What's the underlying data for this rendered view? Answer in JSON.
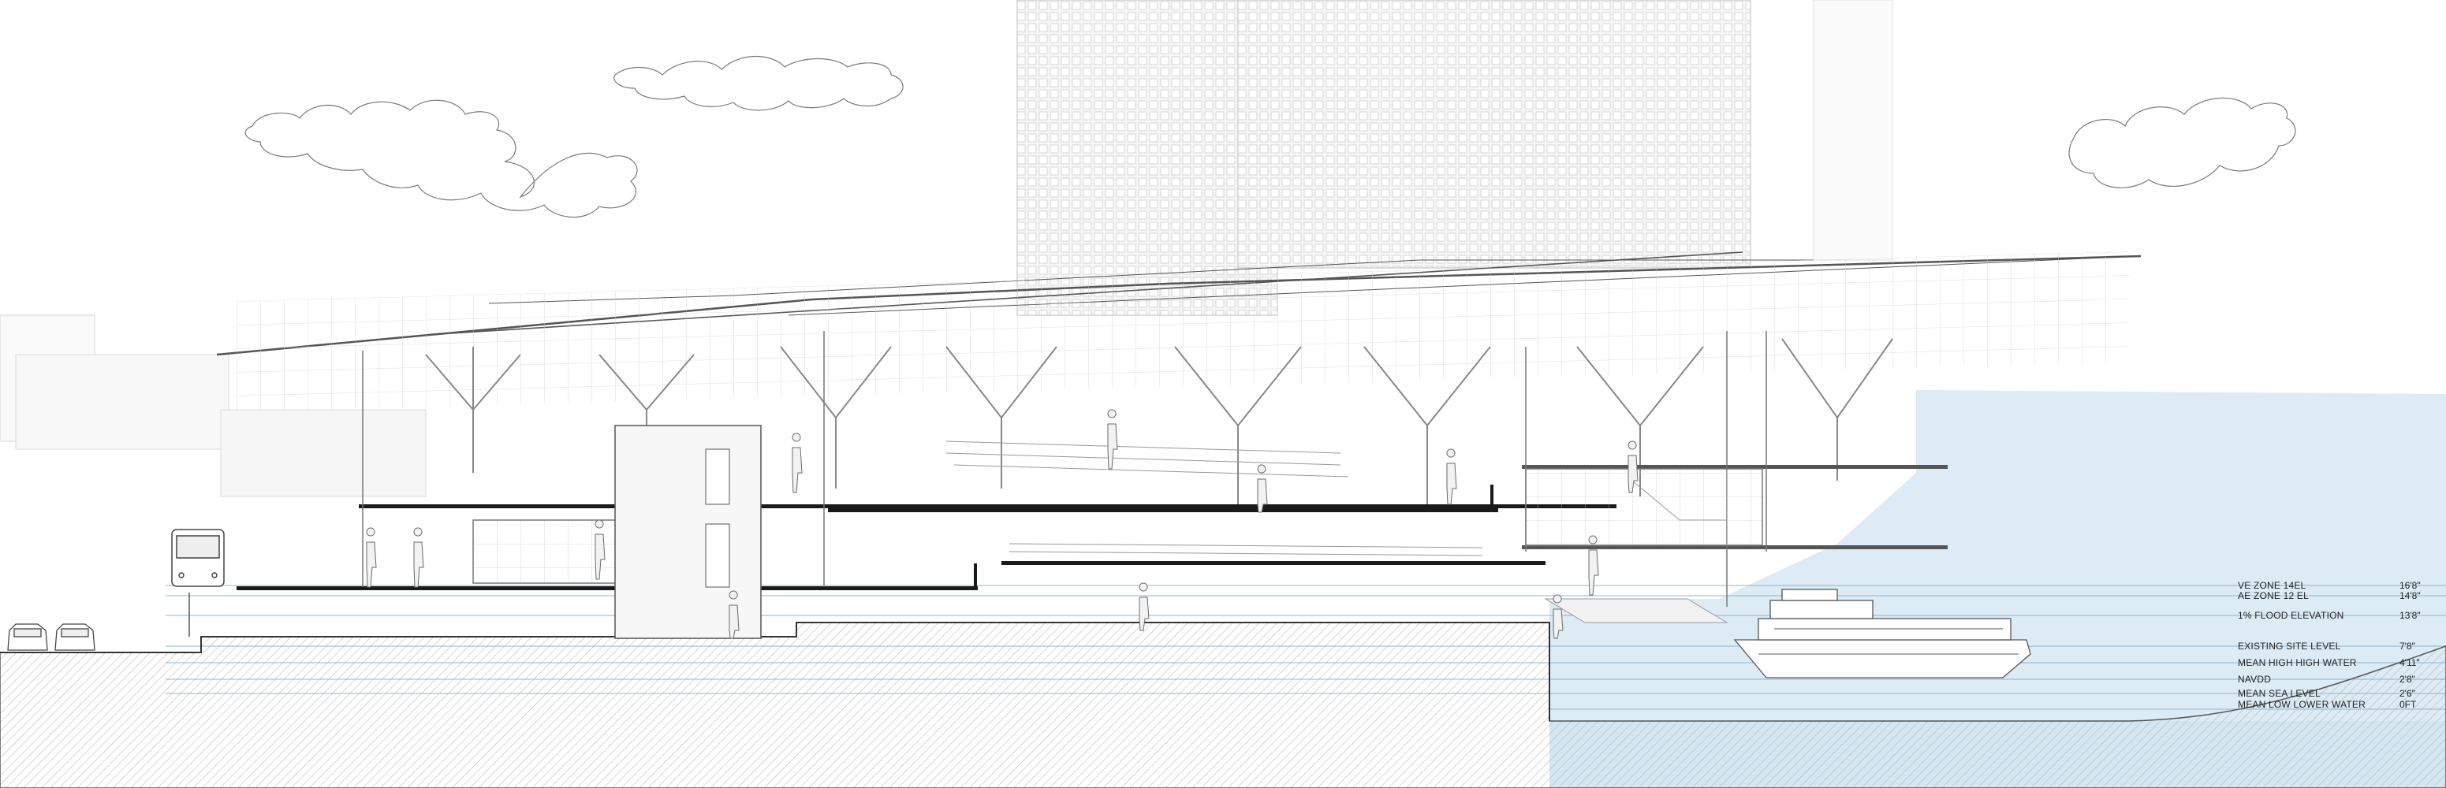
{
  "colors": {
    "water": "#dcebf4",
    "water_line": "#8fb6cf",
    "ground_hatch": "#9a9a9a",
    "linework": "#6b6b6b",
    "slab": "#1a1a1a",
    "tower_fill": "#f4f4f4",
    "tower_grid": "#c8c8c8"
  },
  "elevations": [
    {
      "label": "VE ZONE 14EL",
      "value": "16'8\""
    },
    {
      "label": "AE ZONE 12 EL",
      "value": "14'8\""
    },
    {
      "label": "1% FLOOD ELEVATION",
      "value": "13'8\""
    },
    {
      "label": "EXISTING SITE LEVEL",
      "value": "7'8\""
    },
    {
      "label": "MEAN HIGH HIGH WATER",
      "value": "4'11\""
    },
    {
      "label": "NAVDD",
      "value": "2'8\""
    },
    {
      "label": "MEAN SEA LEVEL",
      "value": "2'6\""
    },
    {
      "label": "MEAN LOW LOWER WATER",
      "value": "0FT"
    }
  ],
  "icons": [
    "cloud-icon",
    "bus-icon",
    "car-icon",
    "ferry-icon",
    "person-icon"
  ]
}
